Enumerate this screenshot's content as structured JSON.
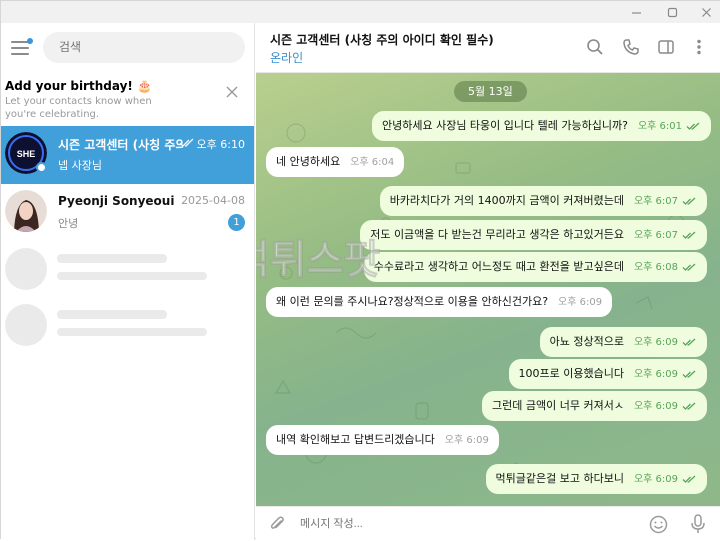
{
  "sidebar": {
    "search_placeholder": "검색",
    "birthday": {
      "title": "Add your birthday! 🎂",
      "subtitle": "Let your contacts know when you're celebrating."
    },
    "chats": [
      {
        "name": "시즌 고객센터 (사칭 주의 아이디 확인 필수)",
        "time": "오후 6:10",
        "last_message": "넵 사장님",
        "active": true,
        "avatar_text": "SHE"
      },
      {
        "name": "Pyeonji Sonyeoui",
        "time": "2025-04-08",
        "last_message": "안녕",
        "unread": "1"
      }
    ]
  },
  "header": {
    "title": "시즌 고객센터 (사칭 주의 아이디 확인 필수)",
    "status": "온라인"
  },
  "chat": {
    "date": "5월 13일",
    "messages": [
      {
        "dir": "out",
        "text": "안녕하세요 사장님 타웅이 입니다 텔레 가능하십니까?",
        "time": "오후 6:01"
      },
      {
        "dir": "in",
        "text": "네 안녕하세요",
        "time": "오후 6:04"
      },
      {
        "dir": "out",
        "text": "바카라치다가 거의 1400까지 금액이 커져버렸는데",
        "time": "오후 6:07"
      },
      {
        "dir": "out",
        "text": "저도 이금액을 다 받는건 무리라고 생각은 하고있거든요",
        "time": "오후 6:07"
      },
      {
        "dir": "out",
        "text": "수수료라고 생각하고 어느정도 때고 환전을 받고싶은데",
        "time": "오후 6:08"
      },
      {
        "dir": "in",
        "text": "왜 이런 문의를 주시나요?정상적으로 이용을 안하신건가요?",
        "time": "오후 6:09"
      },
      {
        "dir": "out",
        "text": "아뇨 정상적으로",
        "time": "오후 6:09"
      },
      {
        "dir": "out",
        "text": "100프로 이용했습니다",
        "time": "오후 6:09"
      },
      {
        "dir": "out",
        "text": "그런데 금액이 너무 커져서ㅅ",
        "time": "오후 6:09"
      },
      {
        "dir": "in",
        "text": "내역 확인해보고 답변드리겠습니다",
        "time": "오후 6:09"
      },
      {
        "dir": "out",
        "text": "먹튀글같은걸 보고 하다보니",
        "time": "오후 6:09"
      }
    ],
    "watermark": "먹튀스팟"
  },
  "composer": {
    "placeholder": "메시지 작성..."
  },
  "colors": {
    "accent": "#419fd9",
    "outgoing_bubble": "#effdde",
    "chat_bg": "#95bc84"
  }
}
